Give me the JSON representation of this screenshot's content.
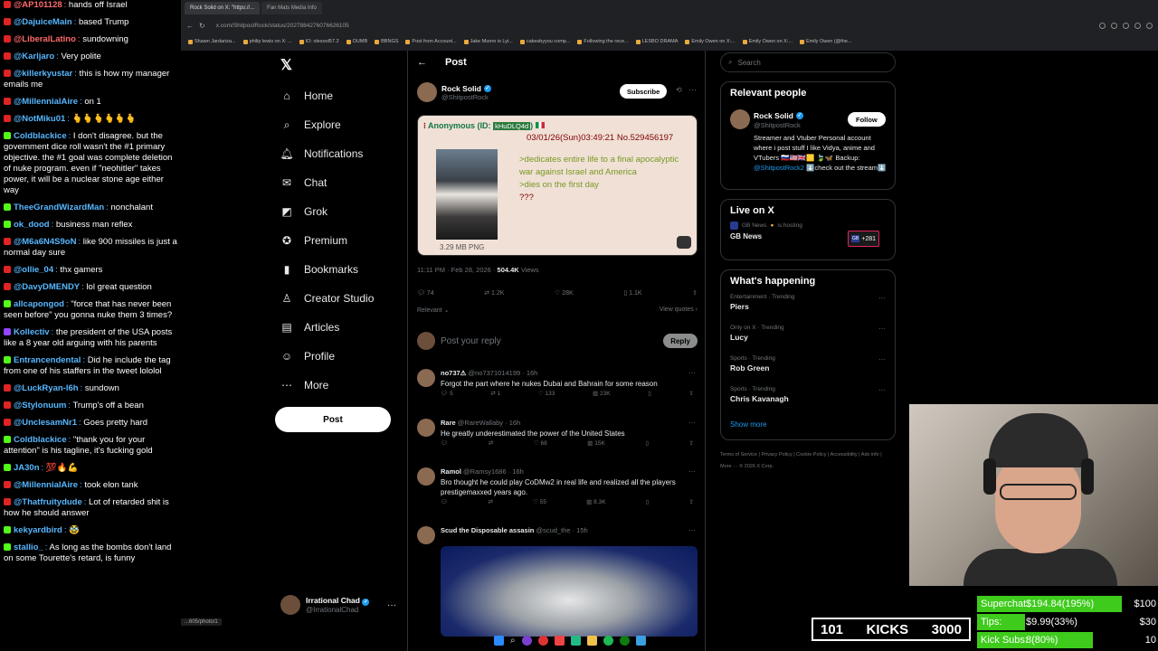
{
  "chat": {
    "messages": [
      {
        "badge": "yt",
        "user": "@AP101128",
        "color": "#ff6b6b",
        "text": "hands off Israel"
      },
      {
        "badge": "yt",
        "user": "@DajuiceMain",
        "color": "#57b7ff",
        "text": "based Trump"
      },
      {
        "badge": "yt",
        "user": "@LiberalLatino",
        "color": "#ff6b6b",
        "text": "sundowning"
      },
      {
        "badge": "yt",
        "user": "@Karljaro",
        "color": "#57b7ff",
        "text": "Very polite"
      },
      {
        "badge": "yt",
        "user": "@killerkyustar",
        "color": "#57b7ff",
        "text": "this is how my manager emails me"
      },
      {
        "badge": "yt",
        "user": "@MillennialAire",
        "color": "#57b7ff",
        "text": "on 1"
      },
      {
        "badge": "yt",
        "user": "@NotMiku01",
        "color": "#57b7ff",
        "text": "🫰🫰🫰🫰🫰🫰"
      },
      {
        "badge": "kk",
        "user": "Coldblackice",
        "color": "#57b7ff",
        "text": "I don't disagree. but the government dice roll wasn't the #1 primary objective. the #1 goal was complete deletion of nuke program. even if \"neohitler\" takes power, it will be a nuclear stone age either way"
      },
      {
        "badge": "kk",
        "user": "TheeGrandWizardMan",
        "color": "#57b7ff",
        "text": "nonchalant"
      },
      {
        "badge": "kk",
        "user": "ok_dood",
        "color": "#57b7ff",
        "text": "business man reflex"
      },
      {
        "badge": "yt",
        "user": "@M6a6N4S9oN",
        "color": "#57b7ff",
        "text": "like 900 missiles is just a normal day sure"
      },
      {
        "badge": "yt",
        "user": "@ollie_04",
        "color": "#57b7ff",
        "text": "thx gamers"
      },
      {
        "badge": "yt",
        "user": "@DavyDMENDY",
        "color": "#57b7ff",
        "text": "lol great question"
      },
      {
        "badge": "kk",
        "user": "allcapongod",
        "color": "#57b7ff",
        "text": "\"force that has never been seen before\" you gonna nuke them 3 times?"
      },
      {
        "badge": "tw",
        "user": "Kollectiv",
        "color": "#57b7ff",
        "text": "the president of the USA posts like a 8 year old arguing with his parents"
      },
      {
        "badge": "kk",
        "user": "Entrancendental",
        "color": "#57b7ff",
        "text": "Did he include the tag from one of his staffers in the tweet lololol"
      },
      {
        "badge": "yt",
        "user": "@LuckRyan-l6h",
        "color": "#57b7ff",
        "text": "sundown"
      },
      {
        "badge": "yt",
        "user": "@Stylonuum",
        "color": "#57b7ff",
        "text": "Trump's off a bean"
      },
      {
        "badge": "yt",
        "user": "@UnclesamNr1",
        "color": "#57b7ff",
        "text": "Goes pretty hard"
      },
      {
        "badge": "kk",
        "user": "Coldblackice",
        "color": "#57b7ff",
        "text": "\"thank you for your attention\" is his tagline, it's fucking gold"
      },
      {
        "badge": "kk",
        "user": "JA30n",
        "color": "#57b7ff",
        "text": "💯🔥💪"
      },
      {
        "badge": "yt",
        "user": "@MillennialAire",
        "color": "#57b7ff",
        "text": "took elon tank"
      },
      {
        "badge": "yt",
        "user": "@Thatfruitydude",
        "color": "#57b7ff",
        "text": "Lot of retarded shit is how he should answer"
      },
      {
        "badge": "kk",
        "user": "kekyardbird",
        "color": "#57b7ff",
        "text": "🥸"
      },
      {
        "badge": "kk",
        "user": "stallio_",
        "color": "#57b7ff",
        "text": "As long as the bombs don't land on some Tourette's retard, is funny"
      }
    ]
  },
  "browser": {
    "tabs": [
      "Rock Solid on X: \"https://...",
      "Fan Mats Media Info"
    ],
    "url": "x.com/ShitpostRock/status/2027884276076626105",
    "bookmarks": [
      "Shawn Jardariza...",
      "philip lewis on X: ...",
      "IO: olesool57.2",
      "OUMB",
      "BBNGS",
      "Post from Account...",
      "Jake Munro is Lyi...",
      "cakesbyyou comp...",
      "Following the rece...",
      "LESBO DRAMA",
      "Emily Owen on X:...",
      "Emily Owen on X:...",
      "Emily Owen (@the..."
    ],
    "status_url": "...605/photo/1"
  },
  "x": {
    "logo": "𝕏",
    "nav": [
      {
        "label": "Home",
        "icon": "⌂",
        "name": "home"
      },
      {
        "label": "Explore",
        "icon": "⌕",
        "name": "explore"
      },
      {
        "label": "Notifications",
        "icon": "🔔︎",
        "name": "notifications"
      },
      {
        "label": "Chat",
        "icon": "✉︎",
        "name": "chat"
      },
      {
        "label": "Grok",
        "icon": "◩",
        "name": "grok"
      },
      {
        "label": "Premium",
        "icon": "✪",
        "name": "premium"
      },
      {
        "label": "Bookmarks",
        "icon": "▮",
        "name": "bookmarks"
      },
      {
        "label": "Creator Studio",
        "icon": "♙",
        "name": "creator-studio"
      },
      {
        "label": "Articles",
        "icon": "▤",
        "name": "articles"
      },
      {
        "label": "Profile",
        "icon": "☺",
        "name": "profile"
      },
      {
        "label": "More",
        "icon": "⋯",
        "name": "more"
      }
    ],
    "post_button": "Post",
    "account": {
      "name": "Irrational Chad",
      "handle": "@IrrationalChad"
    }
  },
  "post": {
    "header_title": "Post",
    "author": {
      "name": "Rock Solid",
      "handle": "@ShitpostRock"
    },
    "subscribe_label": "Subscribe",
    "image": {
      "poster": "Anonymous (ID:",
      "id": "kHuDLQ4d",
      "date": "03/01/26(Sun)03:49:21 No.529456197",
      "lines": [
        ">dedicates entire life to a final apocalyptic war against Israel and America",
        ">dies on the first day"
      ],
      "tail": "???",
      "size": "3.29 MB PNG"
    },
    "time": "11:11 PM · Feb 28, 2026 ·",
    "views_value": "504.4K",
    "views_label": "Views",
    "stats": {
      "replies": "74",
      "reposts": "1.2K",
      "likes": "28K",
      "bookmarks": "1.1K"
    },
    "sort_label": "Relevant ⌄",
    "view_quotes": "View quotes ›",
    "reply_placeholder": "Post your reply",
    "reply_button": "Reply"
  },
  "replies": [
    {
      "name": "no737⚠",
      "meta": "@no7371014199 · 16h",
      "text": "Forgot the part where he nukes Dubai and Bahrain for some reason",
      "stats": [
        "5",
        "1",
        "133",
        "23K"
      ]
    },
    {
      "name": "Rare",
      "meta": "@RareWallaby · 16h",
      "text": "He greatly underestimated the power of the United States",
      "stats": [
        "",
        "",
        "68",
        "15K"
      ]
    },
    {
      "name": "Ramol",
      "meta": "@Ramsy1686 · 16h",
      "text": "Bro thought he could play CoDMw2 in real life and realized all the players prestigemaxxed years ago.",
      "stats": [
        "",
        "",
        "55",
        "8.3K"
      ]
    },
    {
      "name": "Scud the Disposable assasin",
      "meta": "@scud_the · 15h",
      "text": "",
      "stats": []
    }
  ],
  "right": {
    "search_placeholder": "Search",
    "relevant_title": "Relevant people",
    "rel_person": {
      "name": "Rock Solid",
      "handle": "@ShitpostRock",
      "follow": "Follow",
      "bio_pre": "Streamer and Vtuber Personal account where i post stuff I like Vidya, anime and VTubers 🇷🇺🇺🇸🇬🇧🟨 🍃🦋 Backup: ",
      "bio_link": "@ShitpostRock2",
      "bio_post": " ⬇️check out the stream⬇️"
    },
    "live_title": "Live on X",
    "live_host": "GB News",
    "live_hosting": "is hosting",
    "live_name": "GB News",
    "live_count": "+281",
    "happening_title": "What's happening",
    "trends": [
      {
        "cat": "Entertainment · Trending",
        "name": "Piers"
      },
      {
        "cat": "Only on X · Trending",
        "name": "Lucy"
      },
      {
        "cat": "Sports · Trending",
        "name": "Rob Green"
      },
      {
        "cat": "Sports · Trending",
        "name": "Chris Kavanagh"
      }
    ],
    "show_more": "Show more",
    "footer": "Terms of Service  |  Privacy Policy  |  Cookie Policy  |  Accessibility  |  Ads info  |  More ···  © 2026 X Corp."
  },
  "overlay": {
    "kicks_count": "101",
    "kicks_label": "KICKS",
    "kicks_goal": "3000",
    "goals": [
      {
        "label": "Superchat",
        "value": "$194.84(195%)",
        "target": "$100",
        "fill": 1.0
      },
      {
        "label": "Tips:",
        "value": "$9.99(33%)",
        "target": "$30",
        "fill": 0.33
      },
      {
        "label": "Kick Subs:",
        "value": "8(80%)",
        "target": "10",
        "fill": 0.8
      }
    ]
  },
  "colors": {
    "accent": "#1d9bf0",
    "kick_green": "#53fc18",
    "goal_green": "#3ecb1c",
    "chat_link": "#57b7ff"
  }
}
